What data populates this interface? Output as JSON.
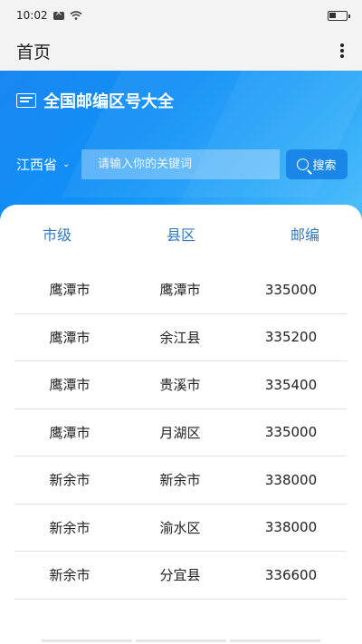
{
  "status_bar": {
    "time": "10:02"
  },
  "app_bar": {
    "title": "首页"
  },
  "hero": {
    "title": "全国邮编区号大全"
  },
  "search": {
    "province": "江西省",
    "placeholder": "请输入你的关键词",
    "button_label": "搜索"
  },
  "table": {
    "headers": [
      "市级",
      "县区",
      "邮编"
    ],
    "rows": [
      [
        "鹰潭市",
        "鹰潭市",
        "335000"
      ],
      [
        "鹰潭市",
        "余江县",
        "335200"
      ],
      [
        "鹰潭市",
        "贵溪市",
        "335400"
      ],
      [
        "鹰潭市",
        "月湖区",
        "335000"
      ],
      [
        "新余市",
        "新余市",
        "338000"
      ],
      [
        "新余市",
        "渝水区",
        "338000"
      ],
      [
        "新余市",
        "分宜县",
        "336600"
      ]
    ]
  },
  "colors": {
    "accent": "#1a87f0",
    "header_text": "#2f79c5"
  }
}
